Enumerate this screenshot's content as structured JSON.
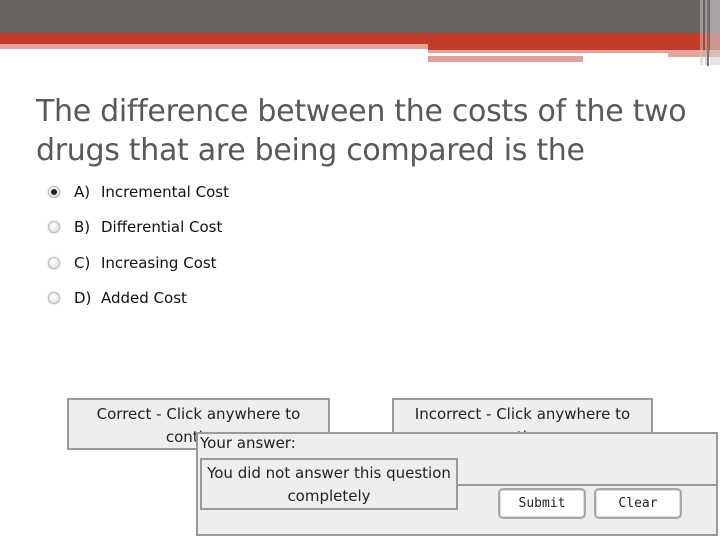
{
  "colors": {
    "header_gray": "#686361",
    "header_red": "#c23b2b",
    "header_pink": "#e5a39c",
    "question_text": "#595959",
    "panel_bg": "#eeeeee",
    "panel_border": "#9a9a9a"
  },
  "question": {
    "text": "The difference between the costs of the two drugs that are being compared is the"
  },
  "options": [
    {
      "letter": "A)",
      "label": "Incremental Cost",
      "selected": true,
      "icon": "radio-checked-icon"
    },
    {
      "letter": "B)",
      "label": "Differential Cost",
      "selected": false,
      "icon": "radio-unchecked-icon"
    },
    {
      "letter": "C)",
      "label": "Increasing Cost",
      "selected": false,
      "icon": "radio-unchecked-icon"
    },
    {
      "letter": "D)",
      "label": "Added Cost",
      "selected": false,
      "icon": "radio-unchecked-icon"
    }
  ],
  "feedback": {
    "correct": "Correct - Click anywhere to continue",
    "incorrect": "Incorrect - Click anywhere to continue"
  },
  "answer_panel": {
    "label": "Your answer:",
    "message": "You did not answer this question completely",
    "submit_label": "Submit",
    "clear_label": "Clear"
  }
}
